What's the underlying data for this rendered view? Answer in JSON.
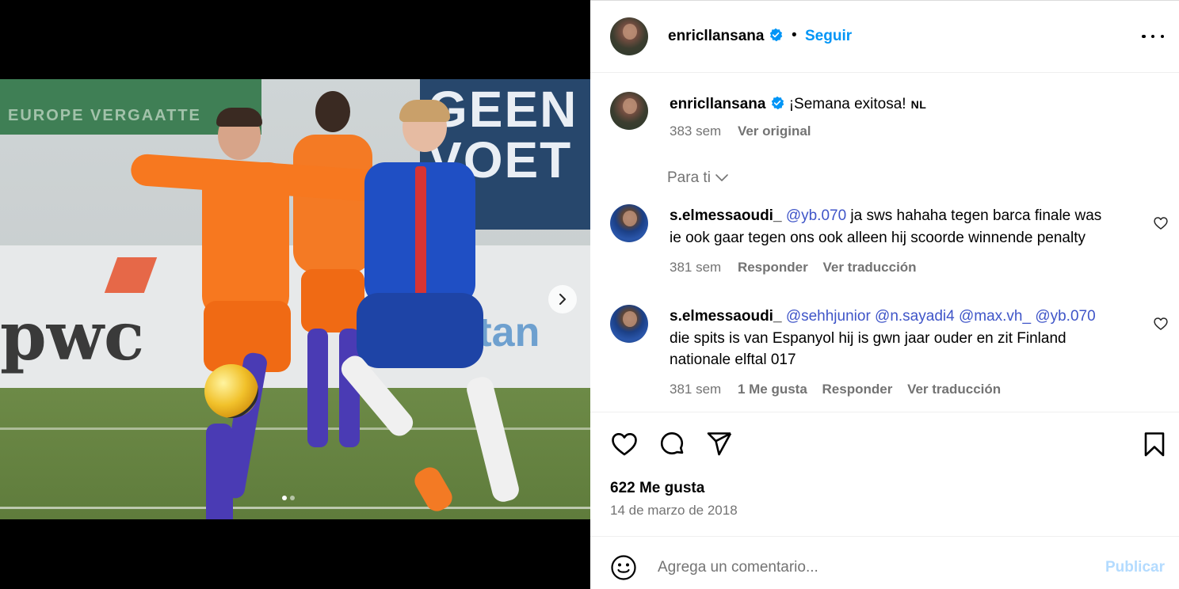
{
  "post": {
    "username": "enricllansana",
    "follow_label": "Seguir",
    "separator": "•",
    "caption": "¡Semana exitosa!",
    "caption_lang": "NL",
    "caption_age": "383 sem",
    "caption_action": "Ver original",
    "for_you_label": "Para ti",
    "likes": "622 Me gusta",
    "date": "14 de marzo de 2018",
    "photo_text": {
      "hoarding_left": "EUROPE VERGAATTE",
      "hoarding_right": "GEEN VOET",
      "sponsor": "pwc",
      "sponsor_right": "vitan"
    },
    "carousel": {
      "total_slides": 2,
      "active_slide": 1
    }
  },
  "comments": [
    {
      "username": "s.elmessaoudi_",
      "mentions": "@yb.070",
      "text_line1": " ja sws hahaha tegen barca finale was",
      "text_line2": "ie ook gaar tegen ons ook alleen hij scoorde winnende penalty",
      "age": "381 sem",
      "reply": "Responder",
      "translate": "Ver traducción"
    },
    {
      "username": "s.elmessaoudi_",
      "mentions": "@sehhjunior @n.sayadi4 @max.vh_ @yb.070",
      "text_line1": "die spits is van Espanyol hij is gwn jaar ouder en zit Finland",
      "text_line2": "nationale elftal 017",
      "age": "381 sem",
      "likes": "1 Me gusta",
      "reply": "Responder",
      "translate": "Ver traducción"
    }
  ],
  "composer": {
    "placeholder": "Agrega un comentario...",
    "publish_label": "Publicar"
  },
  "icons": {
    "verified": "verified-badge-icon",
    "more": "more-options-icon",
    "like": "heart-icon",
    "comment": "comment-icon",
    "share": "share-icon",
    "save": "bookmark-icon",
    "emoji": "emoji-icon",
    "next": "chevron-right-icon",
    "for_you": "chevron-down-icon"
  },
  "colors": {
    "link_blue": "#0095f6",
    "mention_blue": "#3f55c8",
    "meta_gray": "#737373",
    "publish_disabled": "#b3dbff"
  }
}
